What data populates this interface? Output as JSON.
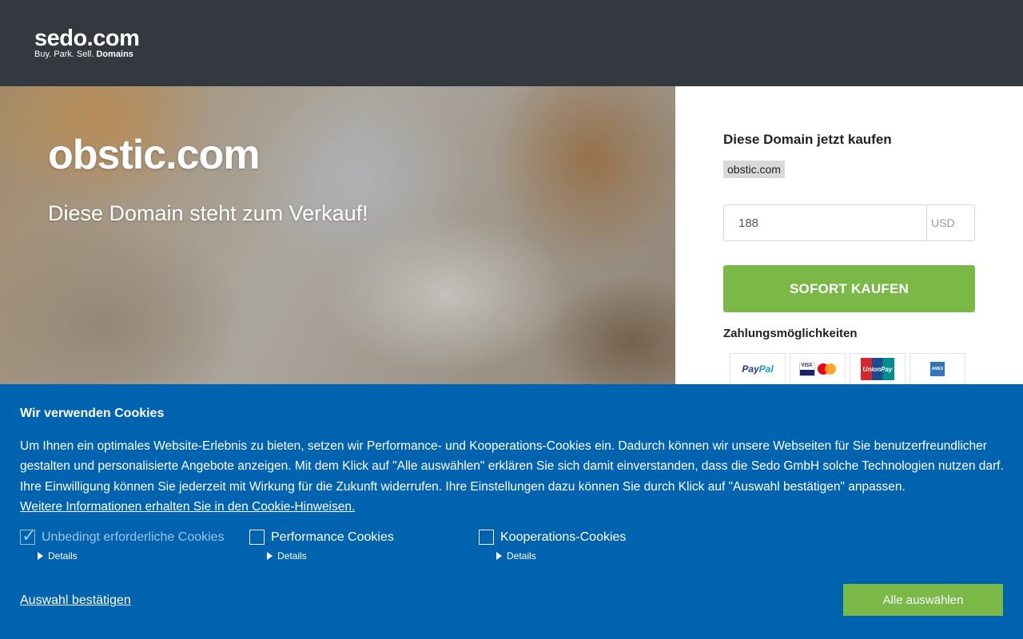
{
  "header": {
    "logo_main": "sedo.com",
    "logo_tag_plain": "Buy.  Park.  Sell.",
    "logo_tag_bold": "Domains"
  },
  "hero": {
    "domain": "obstic.com",
    "subtitle": "Diese Domain steht zum Verkauf!"
  },
  "buy_panel": {
    "title": "Diese Domain jetzt kaufen",
    "domain_chip": "obstic.com",
    "price_value": "188",
    "currency": "USD",
    "buy_button": "SOFORT KAUFEN",
    "payment_title": "Zahlungsmöglichkeiten",
    "payment_methods": [
      {
        "name": "PayPal",
        "icon": "paypal-icon",
        "text_a": "Pay",
        "text_b": "Pal"
      },
      {
        "name": "Visa / Mastercard",
        "icon": "visa-mastercard-icon",
        "text_a": "VISA"
      },
      {
        "name": "UnionPay",
        "icon": "unionpay-icon",
        "text_a": "UnionPay"
      },
      {
        "name": "American Express",
        "icon": "amex-icon",
        "text_a": "AMEX"
      }
    ]
  },
  "cookie_banner": {
    "title": "Wir verwenden Cookies",
    "text": "Um Ihnen ein optimales Website-Erlebnis zu bieten, setzen wir Performance- und Kooperations-Cookies ein. Dadurch können wir unsere Webseiten für Sie benutzerfreundlicher gestalten und personalisierte Angebote anzeigen. Mit dem Klick auf \"Alle auswählen\" erklären Sie sich damit einverstanden, dass die Sedo GmbH solche Technologien nutzen darf. Ihre Einwilligung können Sie jederzeit mit Wirkung für die Zukunft widerrufen. Ihre Einstellungen dazu können Sie durch Klick auf \"Auswahl bestätigen\" anpassen.",
    "more_info_link": "Weitere Informationen erhalten Sie in den Cookie-Hinweisen.",
    "options": [
      {
        "label": "Unbedingt erforderliche Cookies",
        "checked": true,
        "disabled": true,
        "details": "Details"
      },
      {
        "label": "Performance Cookies",
        "checked": false,
        "disabled": false,
        "details": "Details"
      },
      {
        "label": "Kooperations-Cookies",
        "checked": false,
        "disabled": false,
        "details": "Details"
      }
    ],
    "confirm_link": "Auswahl bestätigen",
    "select_all_button": "Alle auswählen"
  },
  "colors": {
    "header_bg": "#343940",
    "accent_green": "#7ab847",
    "cookie_bg": "#0063b0"
  }
}
